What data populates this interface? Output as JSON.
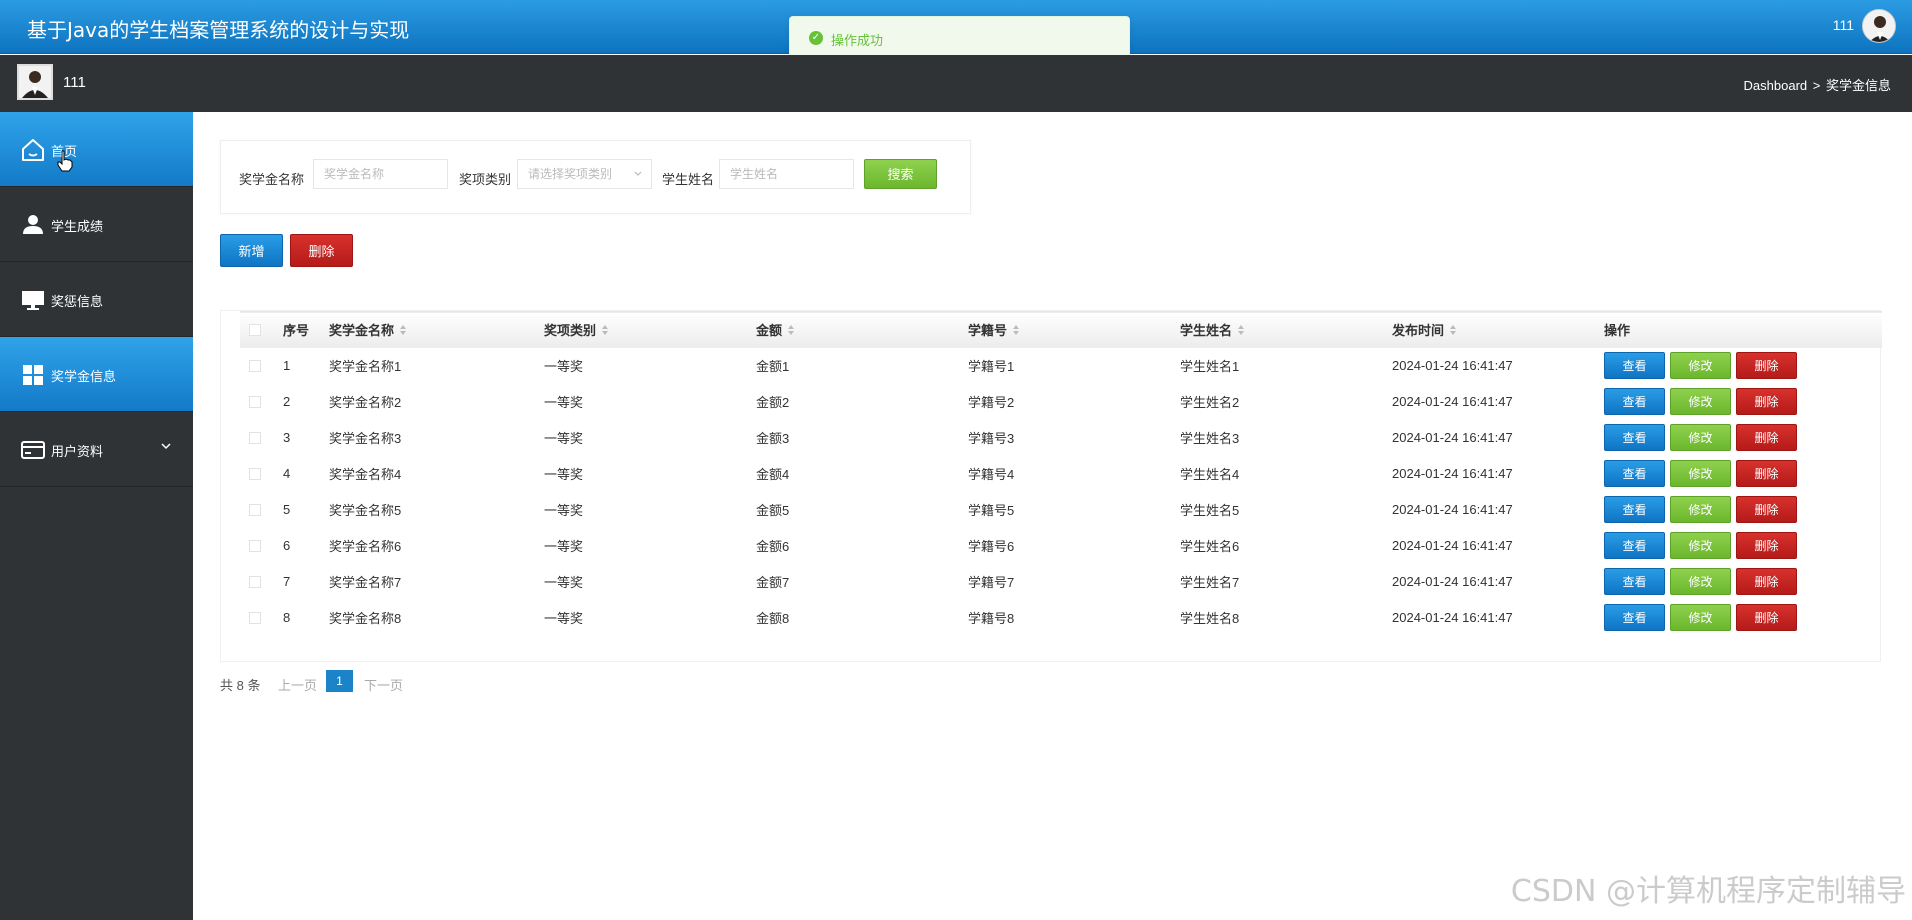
{
  "header": {
    "app_title": "基于Java的学生档案管理系统的设计与实现",
    "user_name": "111"
  },
  "toast": {
    "message": "操作成功"
  },
  "subbar": {
    "user_name": "111",
    "breadcrumb": [
      "Dashboard",
      ">",
      "奖学金信息"
    ]
  },
  "sidebar": {
    "items": [
      {
        "label": "首页",
        "icon": "home-icon",
        "active": true
      },
      {
        "label": "学生成绩",
        "icon": "user-icon",
        "active": false
      },
      {
        "label": "奖惩信息",
        "icon": "monitor-icon",
        "active": false
      },
      {
        "label": "奖学金信息",
        "icon": "grid-icon",
        "active": false
      },
      {
        "label": "用户资料",
        "icon": "card-icon",
        "active": false
      }
    ]
  },
  "search": {
    "name_label": "奖学金名称",
    "name_placeholder": "奖学金名称",
    "type_label": "奖项类别",
    "type_placeholder": "请选择奖项类别",
    "student_label": "学生姓名",
    "student_placeholder": "学生姓名",
    "search_button": "搜索"
  },
  "actions": {
    "add_button": "新增",
    "delete_button": "删除"
  },
  "table": {
    "headers": [
      "序号",
      "奖学金名称",
      "奖项类别",
      "金额",
      "学籍号",
      "学生姓名",
      "发布时间",
      "操作"
    ],
    "row_buttons": {
      "view": "查看",
      "edit": "修改",
      "delete": "删除"
    },
    "rows": [
      {
        "no": "1",
        "name": "奖学金名称1",
        "type": "一等奖",
        "amount": "金额1",
        "sid": "学籍号1",
        "student": "学生姓名1",
        "time": "2024-01-24 16:41:47"
      },
      {
        "no": "2",
        "name": "奖学金名称2",
        "type": "一等奖",
        "amount": "金额2",
        "sid": "学籍号2",
        "student": "学生姓名2",
        "time": "2024-01-24 16:41:47"
      },
      {
        "no": "3",
        "name": "奖学金名称3",
        "type": "一等奖",
        "amount": "金额3",
        "sid": "学籍号3",
        "student": "学生姓名3",
        "time": "2024-01-24 16:41:47"
      },
      {
        "no": "4",
        "name": "奖学金名称4",
        "type": "一等奖",
        "amount": "金额4",
        "sid": "学籍号4",
        "student": "学生姓名4",
        "time": "2024-01-24 16:41:47"
      },
      {
        "no": "5",
        "name": "奖学金名称5",
        "type": "一等奖",
        "amount": "金额5",
        "sid": "学籍号5",
        "student": "学生姓名5",
        "time": "2024-01-24 16:41:47"
      },
      {
        "no": "6",
        "name": "奖学金名称6",
        "type": "一等奖",
        "amount": "金额6",
        "sid": "学籍号6",
        "student": "学生姓名6",
        "time": "2024-01-24 16:41:47"
      },
      {
        "no": "7",
        "name": "奖学金名称7",
        "type": "一等奖",
        "amount": "金额7",
        "sid": "学籍号7",
        "student": "学生姓名7",
        "time": "2024-01-24 16:41:47"
      },
      {
        "no": "8",
        "name": "奖学金名称8",
        "type": "一等奖",
        "amount": "金额8",
        "sid": "学籍号8",
        "student": "学生姓名8",
        "time": "2024-01-24 16:41:47"
      }
    ]
  },
  "pager": {
    "total": "共 8 条",
    "prev": "上一页",
    "current": "1",
    "next": "下一页"
  },
  "watermark": "CSDN @计算机程序定制辅导",
  "colors": {
    "primary": "#1b84c9",
    "success": "#6bb72c",
    "danger": "#b41b19",
    "sidebar": "#2f3336"
  }
}
